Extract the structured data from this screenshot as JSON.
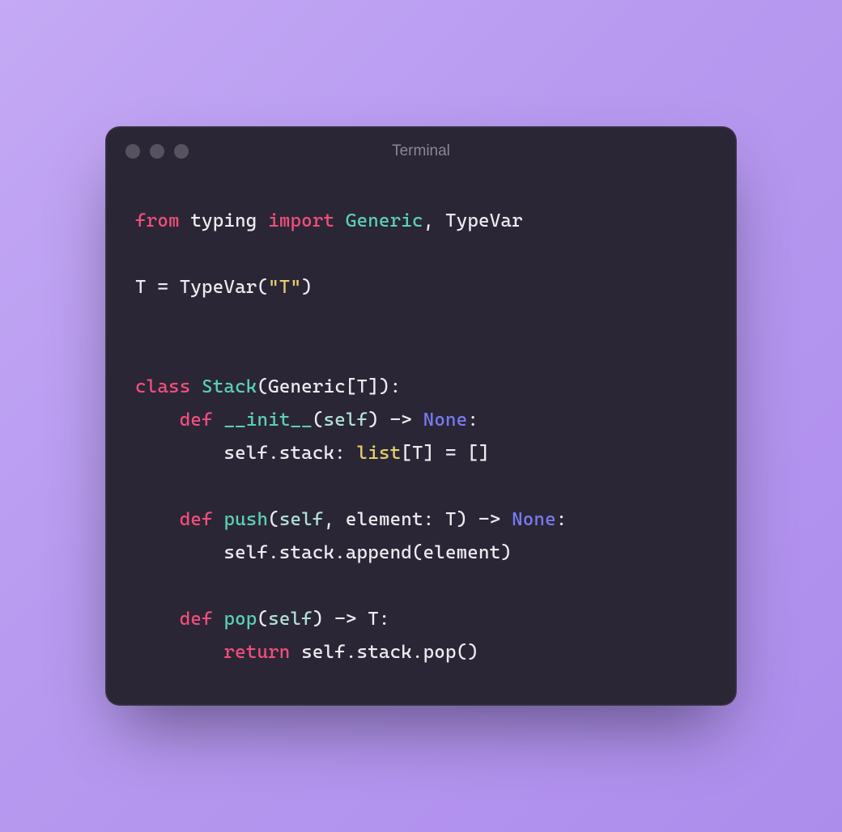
{
  "window": {
    "title": "Terminal"
  },
  "code": {
    "l1": {
      "from": "from",
      "mod": "typing",
      "import": "import",
      "names": "Generic",
      "comma_space": ", ",
      "typevar": "TypeVar"
    },
    "l3": {
      "assign": "T = TypeVar(",
      "str": "\"T\"",
      "close": ")"
    },
    "l6": {
      "class": "class",
      "sp": " ",
      "name": "Stack",
      "open": "(Generic[T]):"
    },
    "l7": {
      "indent": "    ",
      "def": "def",
      "sp": " ",
      "fn": "__init__",
      "open": "(",
      "self": "self",
      "close": ") -> ",
      "none": "None",
      "colon": ":"
    },
    "l8": {
      "indent": "        ",
      "body1": "self.stack: ",
      "list": "list",
      "body2": "[T] = []"
    },
    "l10": {
      "indent": "    ",
      "def": "def",
      "sp": " ",
      "fn": "push",
      "open": "(",
      "self": "self",
      "comma": ", element: T) -> ",
      "none": "None",
      "colon": ":"
    },
    "l11": {
      "indent": "        ",
      "body": "self.stack.append(element)"
    },
    "l13": {
      "indent": "    ",
      "def": "def",
      "sp": " ",
      "fn": "pop",
      "open": "(",
      "self": "self",
      "close": ") -> T:"
    },
    "l14": {
      "indent": "        ",
      "ret": "return",
      "sp": " ",
      "body": "self.stack.pop()"
    }
  }
}
